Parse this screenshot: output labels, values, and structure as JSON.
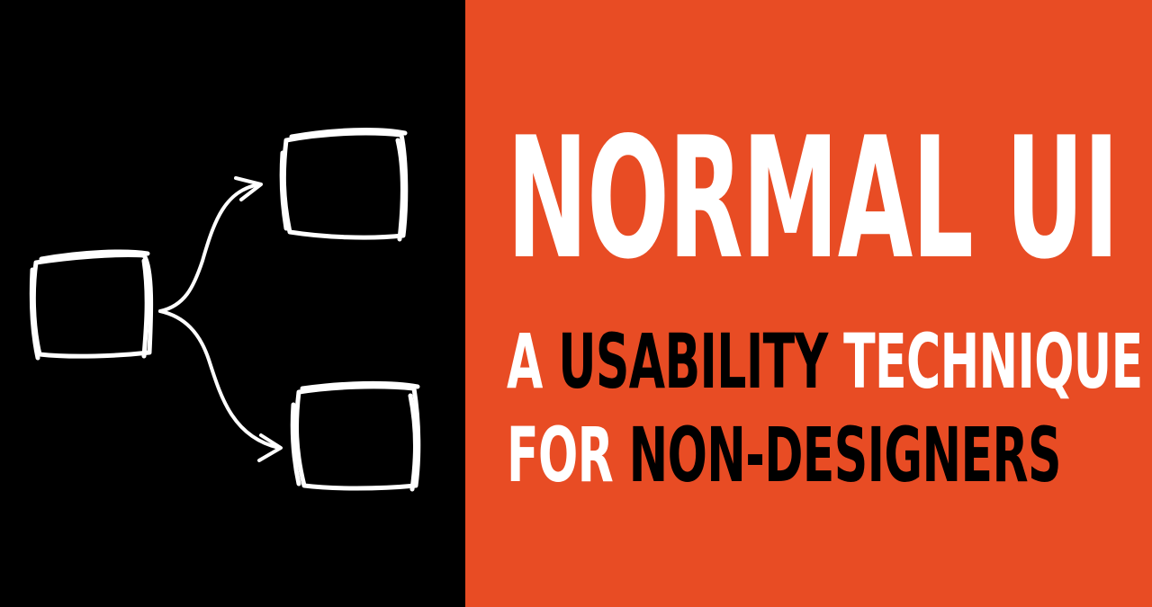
{
  "title": "NORMAL UI",
  "subtitle": {
    "line1": [
      {
        "text": "A",
        "tone": "light"
      },
      {
        "text": "USABILITY",
        "tone": "dark"
      },
      {
        "text": "TECHNIQUE",
        "tone": "light"
      }
    ],
    "line2": [
      {
        "text": "FOR",
        "tone": "light"
      },
      {
        "text": "NON-DESIGNERS",
        "tone": "dark"
      }
    ]
  },
  "colors": {
    "left_background": "#000000",
    "right_background": "#e84c24",
    "light_text": "#ffffff",
    "dark_text": "#000000",
    "sketch_stroke": "#ffffff"
  },
  "illustration": {
    "description_icon": "flow-diagram-sketch-icon"
  }
}
